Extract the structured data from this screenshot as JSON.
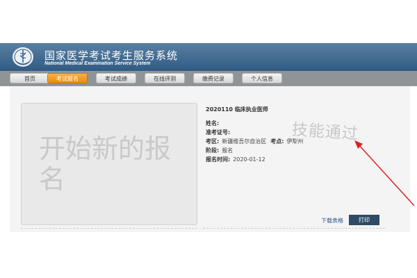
{
  "header": {
    "title": "国家医学考试考生服务系统",
    "subtitle": "National Medical Examination Service System"
  },
  "nav": {
    "items": [
      {
        "label": "首页",
        "active": false
      },
      {
        "label": "考试报名",
        "active": true
      },
      {
        "label": "考试成绩",
        "active": false
      },
      {
        "label": "在线评测",
        "active": false
      },
      {
        "label": "缴费记录",
        "active": false
      },
      {
        "label": "个人信息",
        "active": false
      }
    ]
  },
  "card": {
    "photo_text": "开始新的报名",
    "exam_title": "2020110 临床执业医师",
    "name_label": "姓名:",
    "name_value": "",
    "ticket_label": "准考证号:",
    "ticket_value": "",
    "region_label": "考区:",
    "region_value": "新疆维吾尔自治区",
    "site_label": "考点:",
    "site_value": "伊犁州",
    "stage_label": "阶段:",
    "stage_value": "报名",
    "date_label": "报名时间:",
    "date_value": "2020-01-12",
    "stamp_text": "技能通过",
    "download_label": "下载表格",
    "print_label": "打印"
  },
  "colors": {
    "header": "#2f5b83",
    "nav_bar": "#8f9497",
    "active_tab": "#e98a12",
    "print_button": "#2e4a66",
    "annotation_arrow": "#e02020"
  }
}
